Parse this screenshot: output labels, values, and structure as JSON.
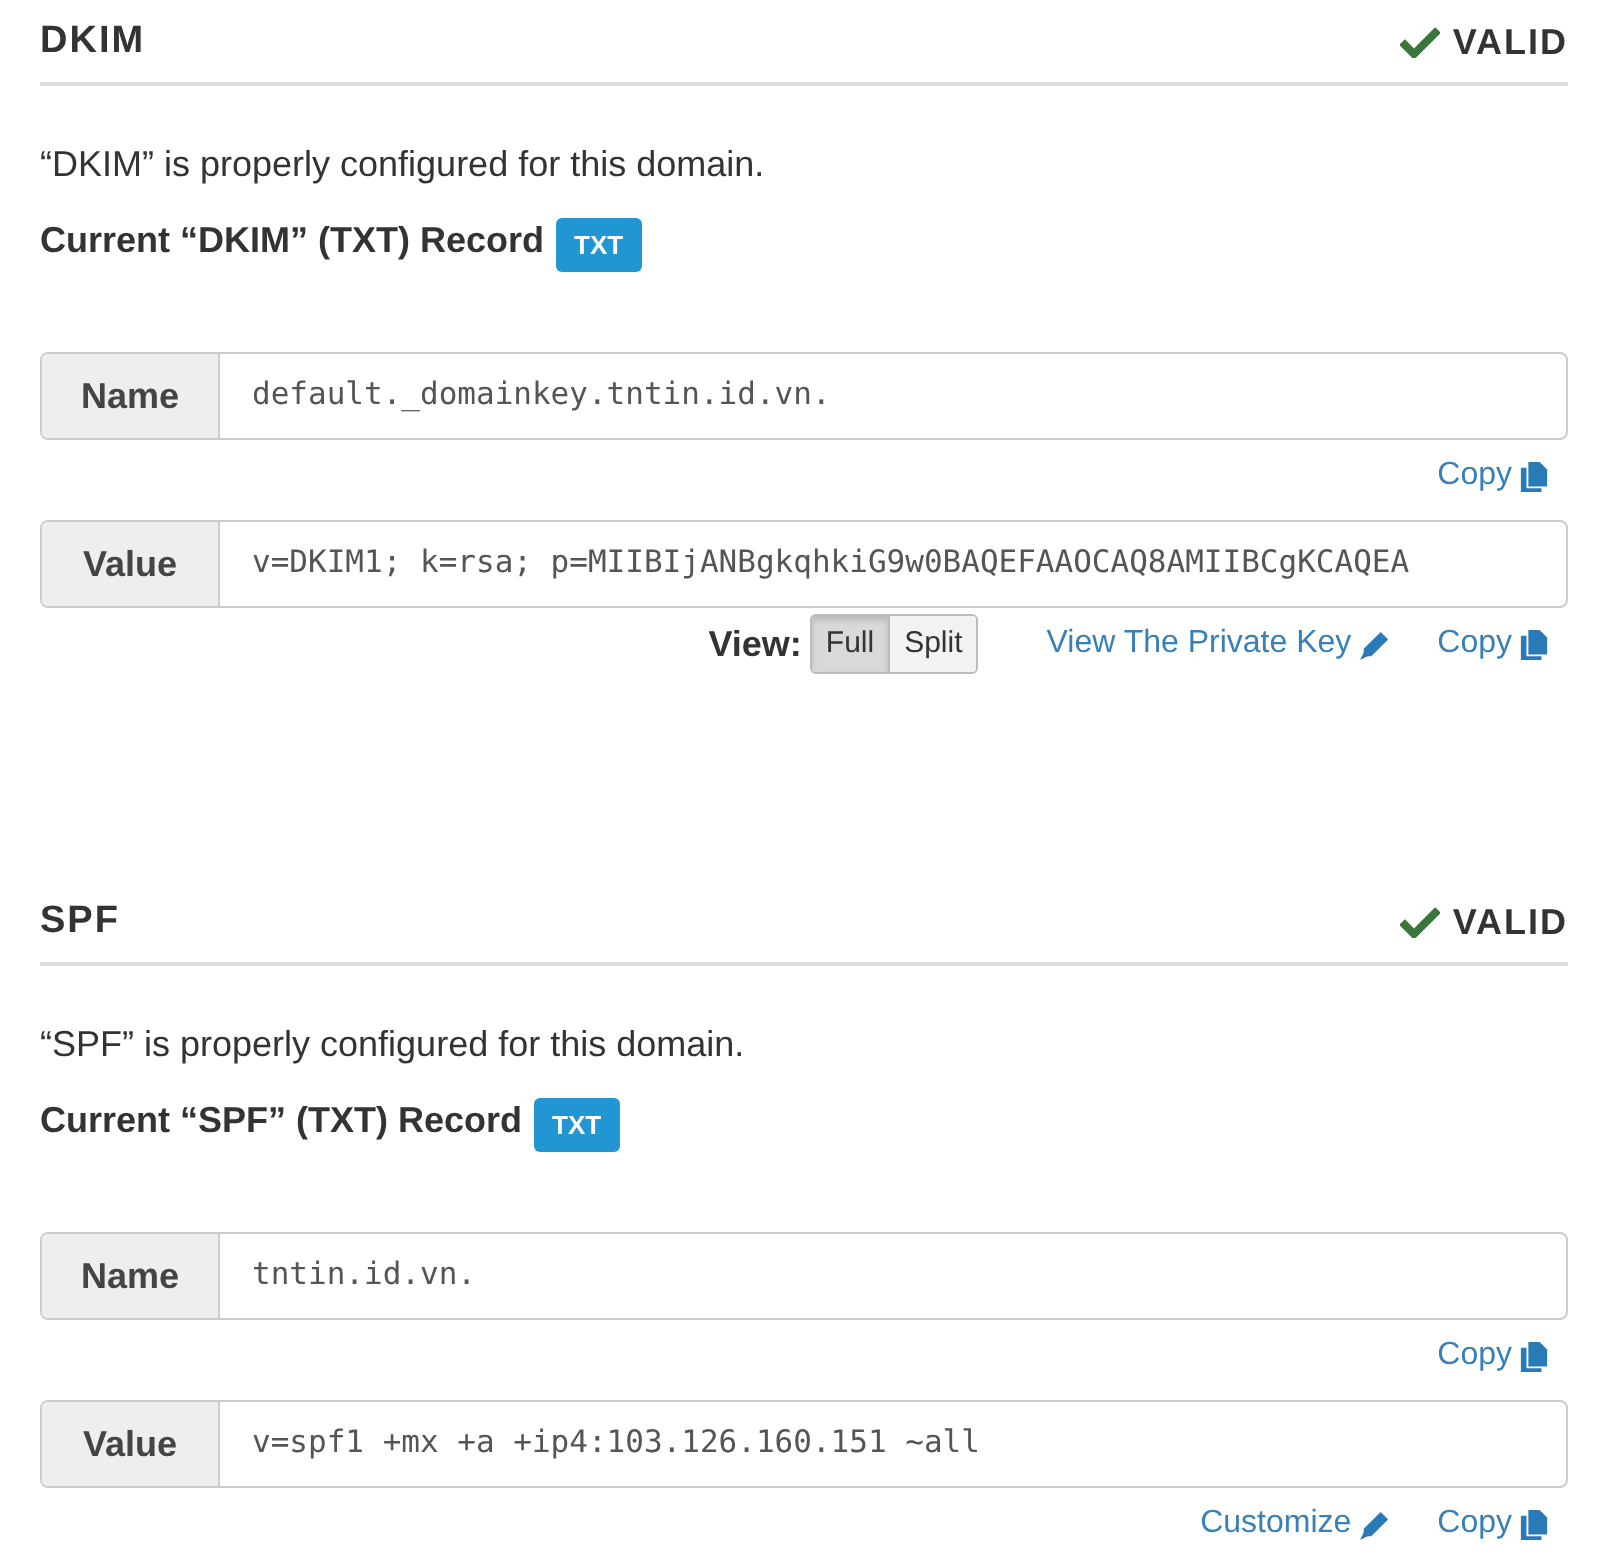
{
  "sections": [
    {
      "title": "DKIM",
      "status": {
        "label": "VALID",
        "valid": true
      },
      "message": "“DKIM” is properly configured for this domain.",
      "record_heading": "Current “DKIM” (TXT) Record",
      "record_badge": "TXT",
      "fields": [
        {
          "label": "Name",
          "value": "default._domainkey.tntin.id.vn.",
          "actions": [
            {
              "kind": "copy",
              "label": "Copy"
            }
          ]
        },
        {
          "label": "Value",
          "value": "v=DKIM1; k=rsa; p=MIIBIjANBgkqhkiG9w0BAQEFAAOCAQ8AMIIBCgKCAQEA",
          "actions": [
            {
              "kind": "view_toggle",
              "label": "View:",
              "options": [
                {
                  "label": "Full",
                  "selected": true
                },
                {
                  "label": "Split",
                  "selected": false
                }
              ]
            },
            {
              "kind": "edit_link",
              "label": "View The Private Key"
            },
            {
              "kind": "copy",
              "label": "Copy"
            }
          ]
        }
      ]
    },
    {
      "title": "SPF",
      "status": {
        "label": "VALID",
        "valid": true
      },
      "message": "“SPF” is properly configured for this domain.",
      "record_heading": "Current “SPF” (TXT) Record",
      "record_badge": "TXT",
      "fields": [
        {
          "label": "Name",
          "value": "tntin.id.vn.",
          "actions": [
            {
              "kind": "copy",
              "label": "Copy"
            }
          ]
        },
        {
          "label": "Value",
          "value": "v=spf1 +mx +a +ip4:103.126.160.151 ~all",
          "actions": [
            {
              "kind": "edit_link",
              "label": "Customize"
            },
            {
              "kind": "copy",
              "label": "Copy"
            }
          ]
        }
      ]
    }
  ]
}
